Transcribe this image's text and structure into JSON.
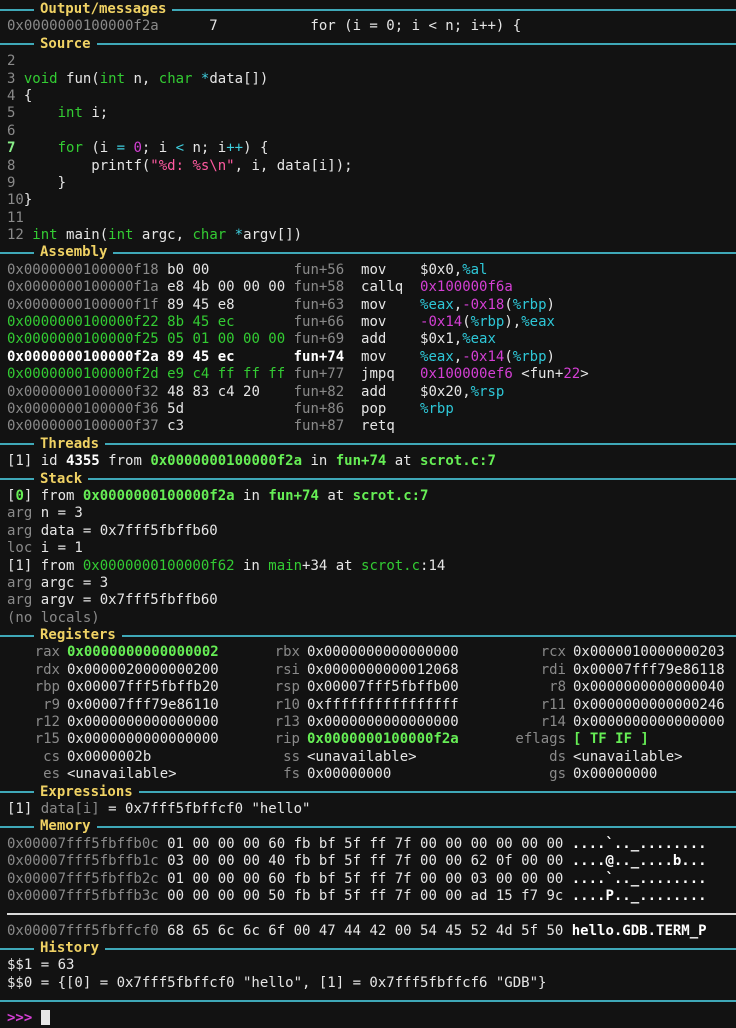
{
  "sections": {
    "output": "Output/messages",
    "source": "Source",
    "assembly": "Assembly",
    "threads": "Threads",
    "stack": "Stack",
    "registers": "Registers",
    "expressions": "Expressions",
    "memory": "Memory",
    "history": "History"
  },
  "output": {
    "addr": "0x0000000100000f2a",
    "line": "      7           for (i = 0; i < n; i++) {"
  },
  "source": {
    "lines": [
      {
        "no": "2",
        "segs": []
      },
      {
        "no": "3",
        "segs": [
          [
            "plain",
            " "
          ],
          [
            "type",
            "void"
          ],
          [
            "plain",
            " fun("
          ],
          [
            "type",
            "int"
          ],
          [
            "plain",
            " n, "
          ],
          [
            "type",
            "char"
          ],
          [
            "plain",
            " "
          ],
          [
            "kw",
            "*"
          ],
          [
            "plain",
            "data[])"
          ]
        ]
      },
      {
        "no": "4",
        "segs": [
          [
            "plain",
            " {"
          ]
        ]
      },
      {
        "no": "5",
        "segs": [
          [
            "plain",
            "     "
          ],
          [
            "type",
            "int"
          ],
          [
            "plain",
            " i;"
          ]
        ]
      },
      {
        "no": "6",
        "segs": []
      },
      {
        "no": "7",
        "cur": true,
        "segs": [
          [
            "plain",
            "     "
          ],
          [
            "type",
            "for"
          ],
          [
            "plain",
            " (i "
          ],
          [
            "kw",
            "="
          ],
          [
            "plain",
            " "
          ],
          [
            "num",
            "0"
          ],
          [
            "plain",
            "; i "
          ],
          [
            "kw",
            "<"
          ],
          [
            "plain",
            " n; i"
          ],
          [
            "kw",
            "++"
          ],
          [
            "plain",
            ") {"
          ]
        ]
      },
      {
        "no": "8",
        "segs": [
          [
            "plain",
            "         printf("
          ],
          [
            "str",
            "\"%d: %s\\n\""
          ],
          [
            "plain",
            ", i, data[i]);"
          ]
        ]
      },
      {
        "no": "9",
        "segs": [
          [
            "plain",
            "     }"
          ]
        ]
      },
      {
        "no": "10",
        "segs": [
          [
            "plain",
            "}"
          ]
        ]
      },
      {
        "no": "11",
        "segs": []
      },
      {
        "no": "12",
        "segs": [
          [
            "plain",
            " "
          ],
          [
            "type",
            "int"
          ],
          [
            "plain",
            " main("
          ],
          [
            "type",
            "int"
          ],
          [
            "plain",
            " argc, "
          ],
          [
            "type",
            "char"
          ],
          [
            "plain",
            " "
          ],
          [
            "kw",
            "*"
          ],
          [
            "plain",
            "argv[])"
          ]
        ]
      }
    ]
  },
  "assembly": {
    "rows": [
      {
        "addr": "0x0000000100000f18",
        "bytes": "b0 00         ",
        "loc": "fun+56",
        "op": "mov  ",
        "args": [
          [
            "plain",
            "$0x0,"
          ],
          [
            "cyan",
            "%al"
          ]
        ],
        "style": "dim"
      },
      {
        "addr": "0x0000000100000f1a",
        "bytes": "e8 4b 00 00 00",
        "loc": "fun+58",
        "op": "callq",
        "args": [
          [
            "mag",
            "0x100000f6a"
          ]
        ],
        "style": "dim"
      },
      {
        "addr": "0x0000000100000f1f",
        "bytes": "89 45 e8      ",
        "loc": "fun+63",
        "op": "mov  ",
        "args": [
          [
            "cyan",
            "%eax"
          ],
          [
            "plain",
            ","
          ],
          [
            "mag",
            "-0x18"
          ],
          [
            "plain",
            "("
          ],
          [
            "cyan",
            "%rbp"
          ],
          [
            "plain",
            ")"
          ]
        ],
        "style": "dim"
      },
      {
        "addr": "0x0000000100000f22",
        "bytes": "8b 45 ec      ",
        "loc": "fun+66",
        "op": "mov  ",
        "args": [
          [
            "mag",
            "-0x14"
          ],
          [
            "plain",
            "("
          ],
          [
            "cyan",
            "%rbp"
          ],
          [
            "plain",
            "),"
          ],
          [
            "cyan",
            "%eax"
          ]
        ],
        "style": "grn"
      },
      {
        "addr": "0x0000000100000f25",
        "bytes": "05 01 00 00 00",
        "loc": "fun+69",
        "op": "add  ",
        "args": [
          [
            "plain",
            "$0x1,"
          ],
          [
            "cyan",
            "%eax"
          ]
        ],
        "style": "grn"
      },
      {
        "addr": "0x0000000100000f2a",
        "bytes": "89 45 ec      ",
        "loc": "fun+74",
        "op": "mov  ",
        "args": [
          [
            "cyan",
            "%eax"
          ],
          [
            "plain",
            ","
          ],
          [
            "mag",
            "-0x14"
          ],
          [
            "plain",
            "("
          ],
          [
            "cyan",
            "%rbp"
          ],
          [
            "plain",
            ")"
          ]
        ],
        "style": "cur"
      },
      {
        "addr": "0x0000000100000f2d",
        "bytes": "e9 c4 ff ff ff",
        "loc": "fun+77",
        "op": "jmpq ",
        "args": [
          [
            "mag",
            "0x100000ef6"
          ],
          [
            "plain",
            " <fun+"
          ],
          [
            "mag",
            "22"
          ],
          [
            "plain",
            ">"
          ]
        ],
        "style": "grn"
      },
      {
        "addr": "0x0000000100000f32",
        "bytes": "48 83 c4 20   ",
        "loc": "fun+82",
        "op": "add  ",
        "args": [
          [
            "plain",
            "$0x20,"
          ],
          [
            "cyan",
            "%rsp"
          ]
        ],
        "style": "dim"
      },
      {
        "addr": "0x0000000100000f36",
        "bytes": "5d            ",
        "loc": "fun+86",
        "op": "pop  ",
        "args": [
          [
            "cyan",
            "%rbp"
          ]
        ],
        "style": "dim"
      },
      {
        "addr": "0x0000000100000f37",
        "bytes": "c3            ",
        "loc": "fun+87",
        "op": "retq ",
        "args": [],
        "style": "dim"
      }
    ]
  },
  "threads": {
    "segs": [
      [
        "plain",
        "[1] id "
      ],
      [
        "bold",
        "4355"
      ],
      [
        "plain",
        " from "
      ],
      [
        "bgrn",
        "0x0000000100000f2a"
      ],
      [
        "plain",
        " in "
      ],
      [
        "bgrn",
        "fun+74"
      ],
      [
        "plain",
        " at "
      ],
      [
        "bgrn",
        "scrot.c:7"
      ]
    ]
  },
  "stack": {
    "lines": [
      [
        [
          "plain",
          "["
        ],
        [
          "bgrn",
          "0"
        ],
        [
          "plain",
          "] from "
        ],
        [
          "bgrn",
          "0x0000000100000f2a"
        ],
        [
          "plain",
          " in "
        ],
        [
          "bgrn",
          "fun+74"
        ],
        [
          "plain",
          " at "
        ],
        [
          "bgrn",
          "scrot.c:7"
        ]
      ],
      [
        [
          "dim",
          "arg "
        ],
        [
          "plain",
          "n = 3"
        ]
      ],
      [
        [
          "dim",
          "arg "
        ],
        [
          "plain",
          "data = 0x7fff5fbffb60"
        ]
      ],
      [
        [
          "dim",
          "loc "
        ],
        [
          "plain",
          "i = 1"
        ]
      ],
      [
        [
          "plain",
          "[1] from "
        ],
        [
          "grn",
          "0x0000000100000f62"
        ],
        [
          "plain",
          " in "
        ],
        [
          "grn",
          "main"
        ],
        [
          "plain",
          "+34 at "
        ],
        [
          "grn",
          "scrot.c"
        ],
        [
          "plain",
          ":14"
        ]
      ],
      [
        [
          "dim",
          "arg "
        ],
        [
          "plain",
          "argc = 3"
        ]
      ],
      [
        [
          "dim",
          "arg "
        ],
        [
          "plain",
          "argv = 0x7fff5fbffb60"
        ]
      ],
      [
        [
          "dim",
          "(no locals)"
        ]
      ]
    ]
  },
  "registers": [
    [
      {
        "n": "rax",
        "v": "0x0000000000000002",
        "chg": true
      },
      {
        "n": "rbx",
        "v": "0x0000000000000000"
      },
      {
        "n": "rcx",
        "v": "0x0000010000000203"
      }
    ],
    [
      {
        "n": "rdx",
        "v": "0x0000020000000200"
      },
      {
        "n": "rsi",
        "v": "0x0000000000012068"
      },
      {
        "n": "rdi",
        "v": "0x00007fff79e86118"
      }
    ],
    [
      {
        "n": "rbp",
        "v": "0x00007fff5fbffb20"
      },
      {
        "n": "rsp",
        "v": "0x00007fff5fbffb00"
      },
      {
        "n": "r8",
        "v": "0x0000000000000040"
      }
    ],
    [
      {
        "n": "r9",
        "v": "0x00007fff79e86110"
      },
      {
        "n": "r10",
        "v": "0xffffffffffffffff"
      },
      {
        "n": "r11",
        "v": "0x0000000000000246"
      }
    ],
    [
      {
        "n": "r12",
        "v": "0x0000000000000000"
      },
      {
        "n": "r13",
        "v": "0x0000000000000000"
      },
      {
        "n": "r14",
        "v": "0x0000000000000000"
      }
    ],
    [
      {
        "n": "r15",
        "v": "0x0000000000000000"
      },
      {
        "n": "rip",
        "v": "0x0000000100000f2a",
        "chg": true
      },
      {
        "n": "eflags",
        "v": "[ TF IF ]",
        "chg": true
      }
    ],
    [
      {
        "n": "cs",
        "v": "0x0000002b"
      },
      {
        "n": "ss",
        "v": "<unavailable>"
      },
      {
        "n": "ds",
        "v": "<unavailable>"
      }
    ],
    [
      {
        "n": "es",
        "v": "<unavailable>"
      },
      {
        "n": "fs",
        "v": "0x00000000"
      },
      {
        "n": "gs",
        "v": "0x00000000"
      }
    ]
  ],
  "expressions": {
    "segs": [
      [
        "plain",
        "[1] "
      ],
      [
        "dim",
        "data[i]"
      ],
      [
        "plain",
        " = 0x7fff5fbffcf0 \"hello\""
      ]
    ]
  },
  "memory": {
    "block1": [
      {
        "addr": "0x00007fff5fbffb0c",
        "hex": "01 00 00 00 60 fb bf 5f ff 7f 00 00 00 00 00 00",
        "ascii": "....`.._........"
      },
      {
        "addr": "0x00007fff5fbffb1c",
        "hex": "03 00 00 00 40 fb bf 5f ff 7f 00 00 62 0f 00 00",
        "ascii": "....@.._....b..."
      },
      {
        "addr": "0x00007fff5fbffb2c",
        "hex": "01 00 00 00 60 fb bf 5f ff 7f 00 00 03 00 00 00",
        "ascii": "....`.._........"
      },
      {
        "addr": "0x00007fff5fbffb3c",
        "hex": "00 00 00 00 50 fb bf 5f ff 7f 00 00 ad 15 f7 9c",
        "ascii": "....P.._........"
      }
    ],
    "block2": [
      {
        "addr": "0x00007fff5fbffcf0",
        "hex": "68 65 6c 6c 6f 00 47 44 42 00 54 45 52 4d 5f 50",
        "ascii": "hello.GDB.TERM_P"
      }
    ]
  },
  "history": {
    "lines": [
      "$$1 = 63",
      "$$0 = {[0] = 0x7fff5fbffcf0 \"hello\", [1] = 0x7fff5fbffcf6 \"GDB\"}"
    ]
  },
  "prompt": {
    "text": ">>>",
    "value": ""
  }
}
